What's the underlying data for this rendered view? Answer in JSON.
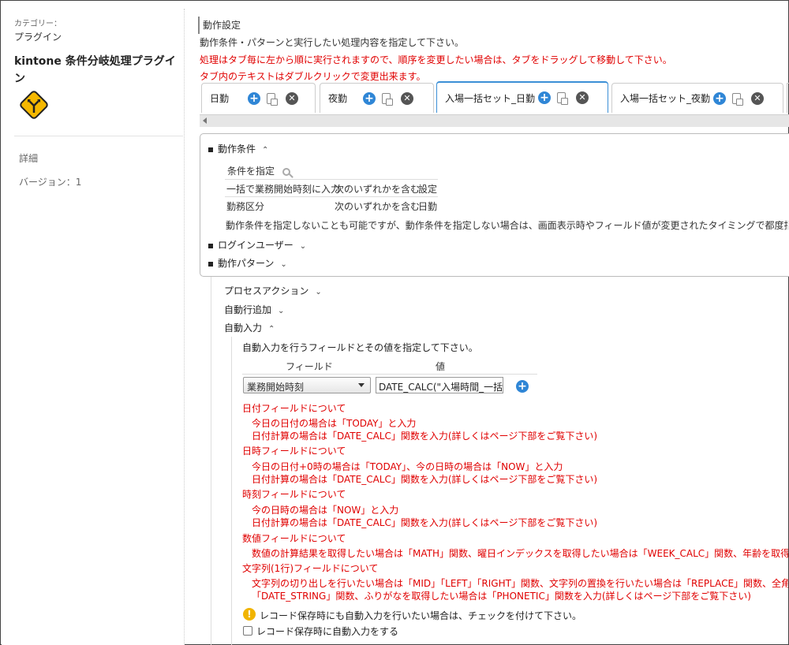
{
  "sidebar": {
    "category_label": "カテゴリー：",
    "category_value": "プラグイン",
    "plugin_title": "kintone 条件分岐処理プラグイン",
    "detail": "詳細",
    "version": "バージョン：1"
  },
  "main": {
    "heading": "動作設定",
    "desc1": "動作条件・パターンと実行したい処理内容を指定して下さい。",
    "desc2": "処理はタブ毎に左から順に実行されますので、順序を変更したい場合は、タブをドラッグして移動して下さい。",
    "desc3": "タブ内のテキストはダブルクリックで変更出来ます。",
    "tabs": [
      {
        "label": "日勤"
      },
      {
        "label": "夜勤"
      },
      {
        "label": "入場一括セット_日勤"
      },
      {
        "label": "入場一括セット_夜勤"
      }
    ],
    "conditions": {
      "title": "動作条件",
      "specify": "条件を指定",
      "row1": [
        "一括で業務開始時刻に入力",
        "次のいずれかを含む",
        "設定"
      ],
      "row2": [
        "勤務区分",
        "次のいずれかを含む",
        "日勤"
      ],
      "note": "動作条件を指定しないことも可能ですが、動作条件を指定しない場合は、画面表示時やフィールド値が変更されたタイミングで都度指定した処理"
    },
    "login_user": "ログインユーザー",
    "action_pattern": "動作パターン",
    "process_action": "プロセスアクション",
    "auto_row_add": "自動行追加",
    "auto_input": "自動入力",
    "auto_input_desc": "自動入力を行うフィールドとその値を指定して下さい。",
    "col_field": "フィールド",
    "col_value": "値",
    "field_select": "業務開始時刻",
    "value_input": "DATE_CALC(\"入場時間_一括\",'",
    "notes": {
      "date_title": "日付フィールドについて",
      "date_1": "今日の日付の場合は「TODAY」と入力",
      "date_2": "日付計算の場合は「DATE_CALC」関数を入力(詳しくはページ下部をご覧下さい)",
      "datetime_title": "日時フィールドについて",
      "datetime_1": "今日の日付+0時の場合は「TODAY」、今の日時の場合は「NOW」と入力",
      "datetime_2": "日付計算の場合は「DATE_CALC」関数を入力(詳しくはページ下部をご覧下さい)",
      "time_title": "時刻フィールドについて",
      "time_1": "今の日時の場合は「NOW」と入力",
      "time_2": "日付計算の場合は「DATE_CALC」関数を入力(詳しくはページ下部をご覧下さい)",
      "num_title": "数値フィールドについて",
      "num_1": "数値の計算結果を取得したい場合は「MATH」関数、曜日インデックスを取得したい場合は「WEEK_CALC」関数、年齢を取得したい場合",
      "str_title": "文字列(1行)フィールドについて",
      "str_1": "文字列の切り出しを行いたい場合は「MID」「LEFT」「RIGHT」関数、文字列の置換を行いたい場合は「REPLACE」関数、全角英数字・",
      "str_2": "「DATE_STRING」関数、ふりがなを取得したい場合は「PHONETIC」関数を入力(詳しくはページ下部をご覧下さい)"
    },
    "warn_text": "レコード保存時にも自動入力を行いたい場合は、チェックを付けて下さい。",
    "checkbox_label": "レコード保存時に自動入力をする"
  },
  "colors": {
    "accent": "#2f86d6",
    "warning_text": "#e00000",
    "warn_icon": "#f1b400"
  },
  "icons": [
    "plugin-logo-icon",
    "plus-circle-icon",
    "copy-icon",
    "close-circle-icon",
    "search-icon",
    "chevron-up-icon",
    "chevron-down-icon",
    "warning-icon"
  ]
}
